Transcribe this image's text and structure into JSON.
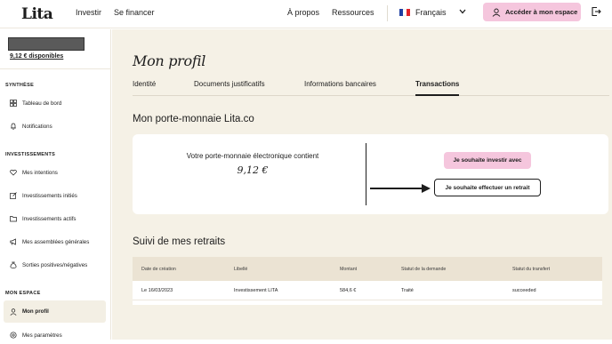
{
  "topbar": {
    "logo": "Lita",
    "nav": [
      "Investir",
      "Se financer"
    ],
    "right_nav": [
      "À propos",
      "Ressources"
    ],
    "language": "Français",
    "cta_label": "Accéder à mon espace"
  },
  "sidebar": {
    "balance": "9,12 € disponibles",
    "sections": [
      {
        "title": "SYNTHÈSE",
        "items": [
          {
            "label": "Tableau de bord",
            "icon": "grid-icon"
          },
          {
            "label": "Notifications",
            "icon": "bell-icon"
          }
        ]
      },
      {
        "title": "INVESTISSEMENTS",
        "items": [
          {
            "label": "Mes intentions",
            "icon": "heart-icon"
          },
          {
            "label": "Investissements initiés",
            "icon": "edit-icon"
          },
          {
            "label": "Investissements actifs",
            "icon": "folder-icon"
          },
          {
            "label": "Mes assemblées générales",
            "icon": "megaphone-icon"
          },
          {
            "label": "Sorties positives/négatives",
            "icon": "money-bag-icon"
          }
        ]
      },
      {
        "title": "MON ESPACE",
        "items": [
          {
            "label": "Mon profil",
            "icon": "user-icon",
            "active": true
          },
          {
            "label": "Mes paramètres",
            "icon": "settings-icon"
          }
        ]
      }
    ]
  },
  "main": {
    "title": "Mon profil",
    "tabs": [
      {
        "label": "Identité"
      },
      {
        "label": "Documents justificatifs"
      },
      {
        "label": "Informations bancaires"
      },
      {
        "label": "Transactions",
        "active": true
      }
    ],
    "wallet_heading": "Mon porte-monnaie Lita.co",
    "wallet_text": "Votre porte-monnaie électronique contient",
    "wallet_amount": "9,12 €",
    "invest_button": "Je souhaite investir avec",
    "withdraw_button": "Je souhaite effectuer un retrait",
    "withdrawals_heading": "Suivi de mes retraits",
    "table": {
      "headers": [
        "Date de création",
        "Libellé",
        "Montant",
        "Statut de la demande",
        "Statut du transfert"
      ],
      "rows": [
        [
          "Le 16/03/2023",
          "Investissement LITA",
          "584,6 €",
          "Traité",
          "succeeded"
        ]
      ]
    }
  },
  "colors": {
    "accent_pink": "#f5c6dd",
    "background_beige": "#f5f1e6",
    "table_header": "#ebe3d3"
  }
}
